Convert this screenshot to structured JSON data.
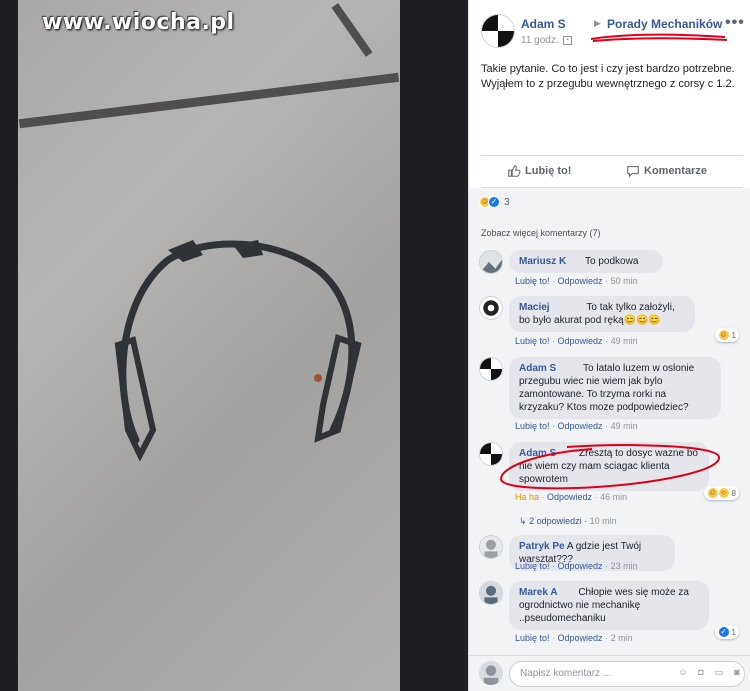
{
  "watermark": "www.wiocha.pl",
  "post": {
    "author": "Adam S",
    "group": "Porady Mechaników",
    "time": "11 godz.",
    "menu": "•••",
    "text": "Takie pytanie. Co to jest i czy jest bardzo potrzebne. Wyjąłem to z przegubu wewnętrznego z corsy c 1.2.",
    "like_label": "Lubię to!",
    "comment_label": "Komentarze",
    "reaction_count": "3",
    "more_comments": "Zobacz więcej komentarzy (7)"
  },
  "comments": [
    {
      "name": "Mariusz K",
      "text": "To podkowa",
      "like": "Lubię to!",
      "reply": "Odpowiedz",
      "time": "50 min"
    },
    {
      "name": "Maciej",
      "text": "To tak tylko założyli, bo było akurat pod ręką😊😊😊",
      "like": "Lubię to!",
      "reply": "Odpowiedz",
      "time": "49 min",
      "reactions": "1"
    },
    {
      "name": "Adam S",
      "text": "To latalo luzem w oslonie przegubu wiec nie wiem jak bylo zamontowane. To trzyma rorki na krzyzaku? Ktos moze podpowiedziec?",
      "like": "Lubię to!",
      "reply": "Odpowiedz",
      "time": "49 min"
    },
    {
      "name": "Adam S",
      "text": "Zresztą to dosyc wazne bo nie wiem czy mam sciagac klienta spowrotem",
      "like": "Ha ha",
      "reply": "Odpowiedz",
      "time": "46 min",
      "reactions": "8",
      "replies": "2 odpowiedzi",
      "replies_time": "10 min"
    },
    {
      "name": "Patryk Pe",
      "text": "A gdzie jest Twój warsztat???",
      "like": "Lubię to!",
      "reply": "Odpowiedz",
      "time": "23 min"
    },
    {
      "name": "Marek A",
      "text": "Chłopie wes się może za ogrodnictwo nie mechanikę ..pseudomechaniku",
      "like": "Lubię to!",
      "reply": "Odpowiedz",
      "time": "2 min",
      "reactions": "1"
    }
  ],
  "composer": {
    "placeholder": "Napisz komentarz ..."
  },
  "colors": {
    "link": "#385898",
    "highlight_red": "#e0001b",
    "bubble": "#e4e6eb"
  }
}
